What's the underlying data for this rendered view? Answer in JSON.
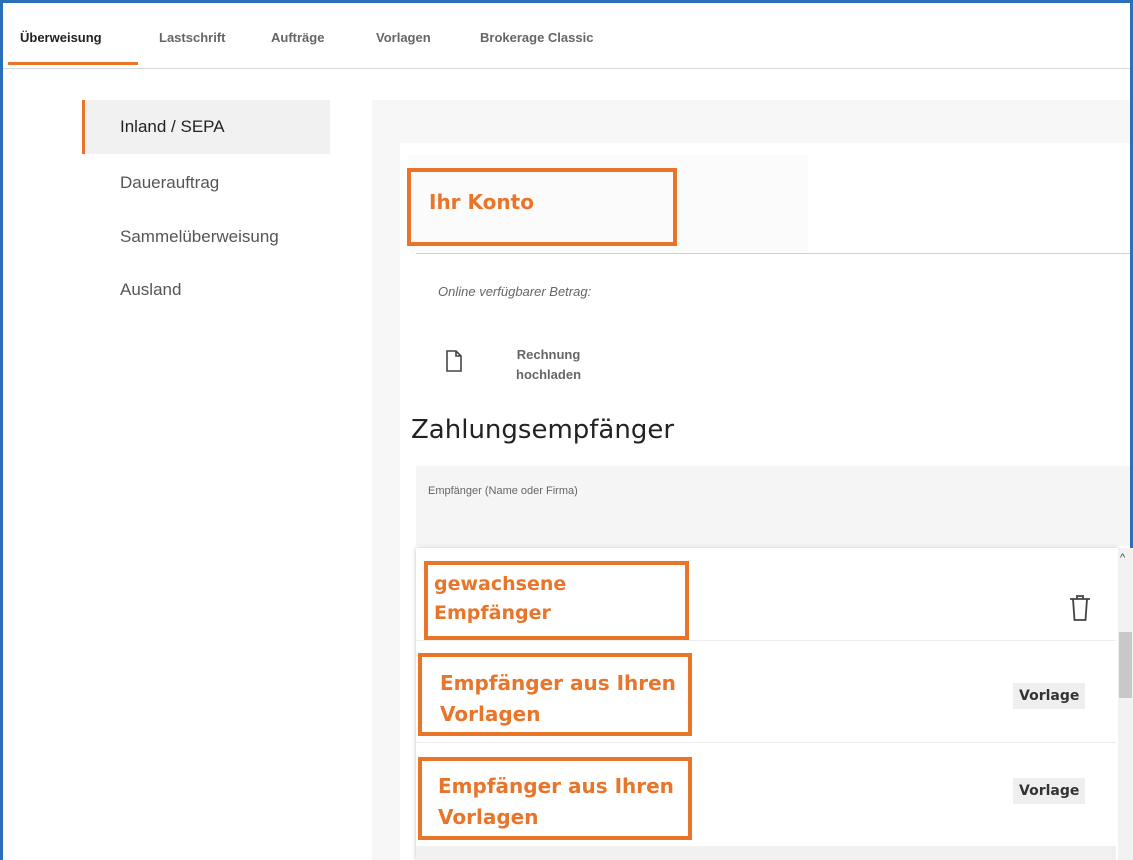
{
  "tabs": [
    {
      "label": "Überweisung",
      "active": true
    },
    {
      "label": "Lastschrift"
    },
    {
      "label": "Aufträge"
    },
    {
      "label": "Vorlagen"
    },
    {
      "label": "Brokerage Classic"
    }
  ],
  "sidebar": {
    "items": [
      {
        "label": "Inland / SEPA",
        "active": true
      },
      {
        "label": "Dauerauftrag"
      },
      {
        "label": "Sammelüberweisung"
      },
      {
        "label": "Ausland"
      }
    ]
  },
  "account": {
    "annotation": "Ihr Konto",
    "online_label": "Online verfügbarer Betrag:"
  },
  "upload": {
    "icon": "document-icon",
    "line1": "Rechnung",
    "line2": "hochladen"
  },
  "payee": {
    "section_title": "Zahlungsempfänger",
    "input_label": "Empfänger (Name oder Firma)",
    "dropdown": [
      {
        "line1": "gewachsene",
        "line2": "Empfänger",
        "action_icon": "trash-icon"
      },
      {
        "line1": "Empfänger aus Ihren",
        "line2": "Vorlagen",
        "badge": "Vorlage"
      },
      {
        "line1": "Empfänger aus Ihren",
        "line2": "Vorlagen",
        "badge": "Vorlage"
      }
    ],
    "scroll_icon": "chevron-up-icon"
  },
  "colors": {
    "accent": "#e8752a",
    "frame": "#2a6fb8"
  }
}
